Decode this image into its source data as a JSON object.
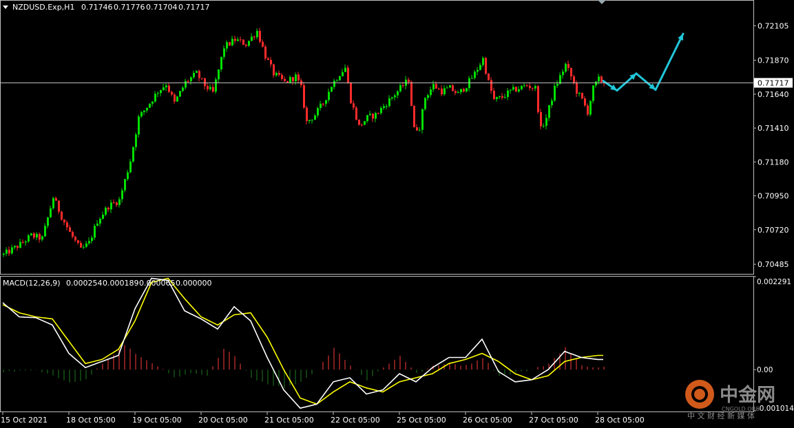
{
  "main_header": {
    "symbol_line": "NZDUSD.Exp,H1",
    "open": "0.71746",
    "high": "0.71776",
    "low": "0.71704",
    "close": "0.71717"
  },
  "macd_header": {
    "label": "MACD(12,26,9)",
    "main": "0.000254",
    "signal": "0.000189",
    "hist": "0.000065",
    "extra": "0.000000"
  },
  "watermark": {
    "brand": "中金网",
    "sub": "中 文 财 经 新 媒 体",
    "site": "CNGOLD.ORG"
  },
  "colors": {
    "background": "#000000",
    "bull_candle": "#00e000",
    "bear_candle": "#ff2b2b",
    "current_price_line": "#c8c8c8",
    "arrow": "#21c6d9",
    "macd_line": "#ffffff",
    "signal_line": "#ffff00",
    "hist_pos": "#ff3b3b",
    "hist_neg": "#1f7a1f"
  },
  "chart_data": [
    {
      "type": "candlestick",
      "symbol": "NZDUSD.Exp",
      "timeframe": "H1",
      "y_ticks": [
        "0.72105",
        "0.71870",
        "0.71640",
        "0.71410",
        "0.71180",
        "0.70950",
        "0.70720",
        "0.70485"
      ],
      "ylim": [
        0.7042,
        0.7227
      ],
      "current_price": "0.71717",
      "x_ticks": [
        "15 Oct 2021",
        "18 Oct 05:00",
        "19 Oct 05:00",
        "20 Oct 05:00",
        "21 Oct 05:00",
        "22 Oct 05:00",
        "25 Oct 05:00",
        "26 Oct 05:00",
        "27 Oct 05:00",
        "28 Oct 05:00"
      ],
      "x_tick_bars": [
        0,
        24,
        48,
        72,
        96,
        120,
        144,
        168,
        192,
        216
      ],
      "bar_count": 219,
      "close_path": [
        [
          0,
          0.7055
        ],
        [
          6,
          0.7062
        ],
        [
          10,
          0.7068
        ],
        [
          14,
          0.7066
        ],
        [
          18,
          0.7094
        ],
        [
          21,
          0.7081
        ],
        [
          24,
          0.707
        ],
        [
          28,
          0.7058
        ],
        [
          31,
          0.7063
        ],
        [
          34,
          0.7078
        ],
        [
          38,
          0.7088
        ],
        [
          42,
          0.7092
        ],
        [
          46,
          0.7119
        ],
        [
          49,
          0.7148
        ],
        [
          53,
          0.7158
        ],
        [
          56,
          0.7166
        ],
        [
          59,
          0.7171
        ],
        [
          62,
          0.7158
        ],
        [
          66,
          0.7172
        ],
        [
          70,
          0.7178
        ],
        [
          73,
          0.717
        ],
        [
          76,
          0.7165
        ],
        [
          80,
          0.7196
        ],
        [
          84,
          0.7201
        ],
        [
          88,
          0.7198
        ],
        [
          92,
          0.7207
        ],
        [
          95,
          0.719
        ],
        [
          98,
          0.7178
        ],
        [
          102,
          0.7172
        ],
        [
          106,
          0.7176
        ],
        [
          108,
          0.7168
        ],
        [
          110,
          0.7145
        ],
        [
          113,
          0.715
        ],
        [
          116,
          0.7158
        ],
        [
          119,
          0.717
        ],
        [
          122,
          0.7178
        ],
        [
          124,
          0.7182
        ],
        [
          126,
          0.716
        ],
        [
          129,
          0.7142
        ],
        [
          132,
          0.7148
        ],
        [
          135,
          0.715
        ],
        [
          138,
          0.7156
        ],
        [
          141,
          0.7162
        ],
        [
          144,
          0.7168
        ],
        [
          147,
          0.7174
        ],
        [
          149,
          0.714
        ],
        [
          151,
          0.7142
        ],
        [
          153,
          0.7162
        ],
        [
          156,
          0.717
        ],
        [
          159,
          0.7166
        ],
        [
          162,
          0.7168
        ],
        [
          165,
          0.7164
        ],
        [
          168,
          0.717
        ],
        [
          171,
          0.7178
        ],
        [
          174,
          0.7188
        ],
        [
          176,
          0.7172
        ],
        [
          178,
          0.716
        ],
        [
          181,
          0.7162
        ],
        [
          184,
          0.7166
        ],
        [
          187,
          0.7168
        ],
        [
          190,
          0.717
        ],
        [
          193,
          0.7168
        ],
        [
          195,
          0.714
        ],
        [
          197,
          0.7148
        ],
        [
          200,
          0.7168
        ],
        [
          202,
          0.7176
        ],
        [
          204,
          0.7184
        ],
        [
          206,
          0.7176
        ],
        [
          208,
          0.7166
        ],
        [
          210,
          0.716
        ],
        [
          212,
          0.7152
        ],
        [
          214,
          0.7168
        ],
        [
          216,
          0.7174
        ],
        [
          218,
          0.7172
        ]
      ],
      "annotation_arrow_path": [
        [
          0.7173,
          0
        ],
        [
          0.71665,
          5
        ],
        [
          0.7178,
          12
        ],
        [
          0.7167,
          19
        ],
        [
          0.7205,
          29
        ]
      ]
    },
    {
      "type": "line",
      "title": "MACD(12,26,9)",
      "y_ticks": [
        "0.002291",
        "0.00",
        "-0.001014"
      ],
      "ylim": [
        -0.001014,
        0.002291
      ],
      "series": [
        {
          "name": "MACD",
          "points": [
            [
              0,
              0.00165
            ],
            [
              6,
              0.0013
            ],
            [
              12,
              0.00128
            ],
            [
              18,
              0.0011
            ],
            [
              24,
              0.0004
            ],
            [
              30,
              5e-05
            ],
            [
              36,
              0.0002
            ],
            [
              42,
              0.00035
            ],
            [
              48,
              0.0015
            ],
            [
              54,
              0.00225
            ],
            [
              60,
              0.0022
            ],
            [
              66,
              0.00145
            ],
            [
              72,
              0.00125
            ],
            [
              78,
              0.001
            ],
            [
              84,
              0.00155
            ],
            [
              90,
              0.0012
            ],
            [
              96,
              0.0003
            ],
            [
              102,
              -0.0005
            ],
            [
              108,
              -0.00095
            ],
            [
              114,
              -0.00085
            ],
            [
              120,
              -0.0003
            ],
            [
              126,
              -0.0002
            ],
            [
              132,
              -0.0006
            ],
            [
              138,
              -0.0005
            ],
            [
              144,
              -0.0001
            ],
            [
              150,
              -0.0003
            ],
            [
              156,
              5e-05
            ],
            [
              162,
              0.0003
            ],
            [
              168,
              0.0003
            ],
            [
              174,
              0.00075
            ],
            [
              180,
              -5e-05
            ],
            [
              186,
              -0.0003
            ],
            [
              192,
              -0.00025
            ],
            [
              198,
              0.0
            ],
            [
              204,
              0.00045
            ],
            [
              210,
              0.0003
            ],
            [
              216,
              0.00025
            ]
          ]
        },
        {
          "name": "Signal",
          "points": [
            [
              0,
              0.0016
            ],
            [
              6,
              0.0014
            ],
            [
              12,
              0.0013
            ],
            [
              18,
              0.00125
            ],
            [
              24,
              0.0007
            ],
            [
              30,
              0.00015
            ],
            [
              36,
              0.00025
            ],
            [
              42,
              0.0005
            ],
            [
              48,
              0.0012
            ],
            [
              54,
              0.00215
            ],
            [
              60,
              0.00225
            ],
            [
              66,
              0.00175
            ],
            [
              72,
              0.0013
            ],
            [
              78,
              0.0011
            ],
            [
              84,
              0.00135
            ],
            [
              90,
              0.0014
            ],
            [
              96,
              0.0008
            ],
            [
              102,
              0.0
            ],
            [
              108,
              -0.0007
            ],
            [
              114,
              -0.00085
            ],
            [
              120,
              -0.00055
            ],
            [
              126,
              -0.0003
            ],
            [
              132,
              -0.00045
            ],
            [
              138,
              -0.00055
            ],
            [
              144,
              -0.0003
            ],
            [
              150,
              -0.0002
            ],
            [
              156,
              -0.0001
            ],
            [
              162,
              0.00015
            ],
            [
              168,
              0.00025
            ],
            [
              174,
              0.0004
            ],
            [
              180,
              0.0002
            ],
            [
              186,
              -0.0001
            ],
            [
              192,
              -0.00025
            ],
            [
              198,
              -0.00015
            ],
            [
              204,
              0.0002
            ],
            [
              210,
              0.0003
            ],
            [
              216,
              0.00035
            ]
          ]
        }
      ],
      "histogram": [
        [
          0,
          -5e-05
        ],
        [
          12,
          -2e-05
        ],
        [
          24,
          -0.0003
        ],
        [
          30,
          -0.00025
        ],
        [
          36,
          0.00015
        ],
        [
          44,
          0.0006
        ],
        [
          50,
          0.0003
        ],
        [
          56,
          0.0001
        ],
        [
          62,
          -0.0002
        ],
        [
          68,
          -0.0001
        ],
        [
          74,
          -0.00015
        ],
        [
          80,
          0.0005
        ],
        [
          84,
          0.00035
        ],
        [
          90,
          -0.0002
        ],
        [
          96,
          -0.00035
        ],
        [
          102,
          -0.00045
        ],
        [
          108,
          -0.0003
        ],
        [
          114,
          0.0
        ],
        [
          120,
          0.00055
        ],
        [
          126,
          0.0001
        ],
        [
          132,
          -0.00025
        ],
        [
          138,
          5e-05
        ],
        [
          144,
          0.00035
        ],
        [
          150,
          -0.0001
        ],
        [
          156,
          8e-05
        ],
        [
          162,
          0.00015
        ],
        [
          168,
          0.0001
        ],
        [
          174,
          0.0003
        ],
        [
          180,
          -0.00015
        ],
        [
          186,
          -8e-05
        ],
        [
          192,
          0.0
        ],
        [
          198,
          0.00015
        ],
        [
          204,
          0.00055
        ],
        [
          210,
          0.0001
        ],
        [
          216,
          6e-05
        ]
      ]
    }
  ]
}
